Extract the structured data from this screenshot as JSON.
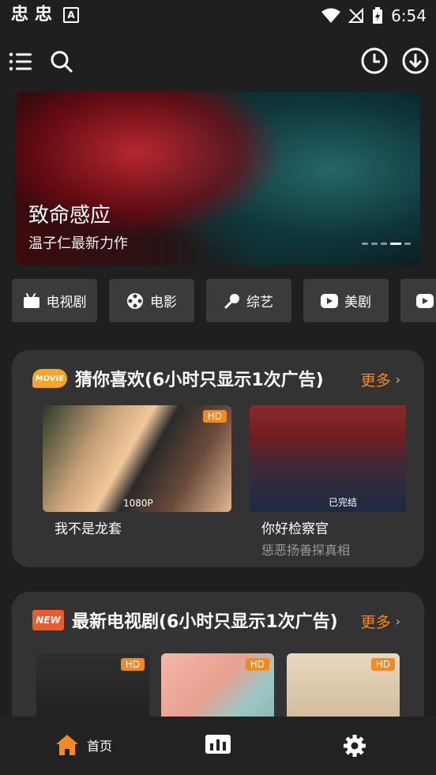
{
  "status_bar": {
    "left_glyphs": [
      "忠",
      "忠"
    ],
    "a_icon": "A",
    "time": "6:54"
  },
  "top_bar": {
    "icons": [
      "menu-icon",
      "search-icon",
      "history-icon",
      "download-icon"
    ]
  },
  "banner": {
    "title": "致命感应",
    "subtitle": "温子仁最新力作"
  },
  "categories": [
    {
      "label": "电视剧",
      "icon": "tv-icon"
    },
    {
      "label": "电影",
      "icon": "film-reel-icon"
    },
    {
      "label": "综艺",
      "icon": "microphone-icon"
    },
    {
      "label": "美剧",
      "icon": "play-icon"
    }
  ],
  "section_recommend": {
    "badge": "MOVIE",
    "title": "猜你喜欢(6小时只显示1次广告)",
    "more": "更多",
    "items": [
      {
        "title": "我不是龙套",
        "tag": "1080P",
        "badge": "HD",
        "subtitle": ""
      },
      {
        "title": "你好检察官",
        "tag": "已完结",
        "badge": "",
        "subtitle": "惩恶扬善探真相"
      }
    ]
  },
  "section_tv": {
    "badge": "NEW",
    "title": "最新电视剧(6小时只显示1次广告)",
    "more": "更多",
    "items": [
      {
        "badge": "HD"
      },
      {
        "badge": "HD"
      },
      {
        "badge": "HD"
      }
    ]
  },
  "bottom_nav": {
    "home": "首页"
  },
  "colors": {
    "accent": "#f08a24",
    "background": "#1f1f1f",
    "card": "#333333",
    "chip": "#3b3b3b"
  }
}
